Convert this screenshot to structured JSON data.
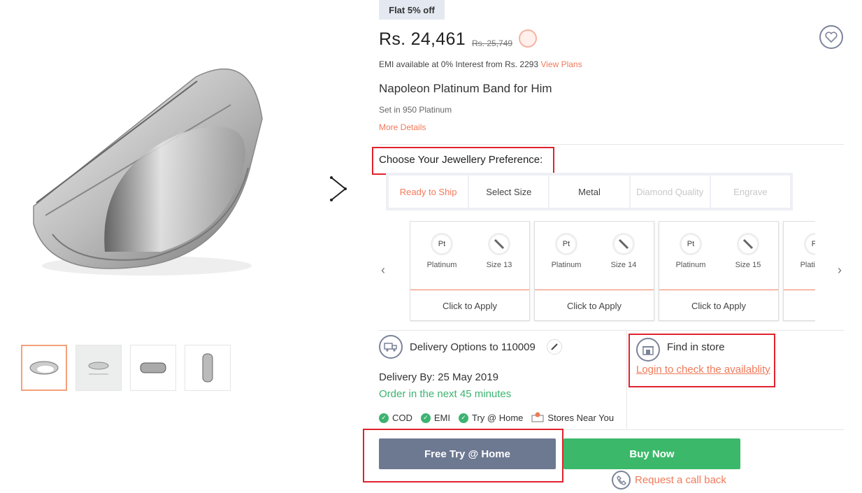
{
  "offer": {
    "badge": "Flat 5% off"
  },
  "price": {
    "current": "Rs. 24,461",
    "original": "Rs. 25,749"
  },
  "emi": {
    "text": "EMI available at 0% Interest from Rs. 2293",
    "link": "View Plans"
  },
  "product": {
    "title": "Napoleon Platinum Band for Him",
    "subtitle": "Set in 950 Platinum",
    "more_details": "More Details"
  },
  "preference": {
    "heading": "Choose Your Jewellery Preference:",
    "tabs": [
      {
        "label": "Ready to Ship",
        "state": "active"
      },
      {
        "label": "Select Size",
        "state": "normal"
      },
      {
        "label": "Metal",
        "state": "normal"
      },
      {
        "label": "Diamond Quality",
        "state": "disabled"
      },
      {
        "label": "Engrave",
        "state": "disabled"
      }
    ]
  },
  "cards": [
    {
      "metal_icon": "Pt",
      "metal": "Platinum",
      "size": "Size 13",
      "action": "Click to Apply"
    },
    {
      "metal_icon": "Pt",
      "metal": "Platinum",
      "size": "Size 14",
      "action": "Click to Apply"
    },
    {
      "metal_icon": "Pt",
      "metal": "Platinum",
      "size": "Size 15",
      "action": "Click to Apply"
    },
    {
      "metal_icon": "Pt",
      "metal": "Platinum",
      "size": "",
      "action": ""
    }
  ],
  "delivery": {
    "title": "Delivery Options to 110009",
    "by": "Delivery By: 25 May 2019",
    "order_in": "Order in the next 45 minutes",
    "features": [
      "COD",
      "EMI",
      "Try @ Home"
    ],
    "stores_near": "Stores Near You"
  },
  "store": {
    "title": "Find in store",
    "link": "Login to check the availablity"
  },
  "actions": {
    "try_home": "Free Try @ Home",
    "buy_now": "Buy Now",
    "call_back": "Request a call back"
  },
  "colors": {
    "accent": "#f07a5a",
    "primary_button": "#6d7891",
    "buy_button": "#3bb869",
    "highlight": "#e0232d"
  }
}
